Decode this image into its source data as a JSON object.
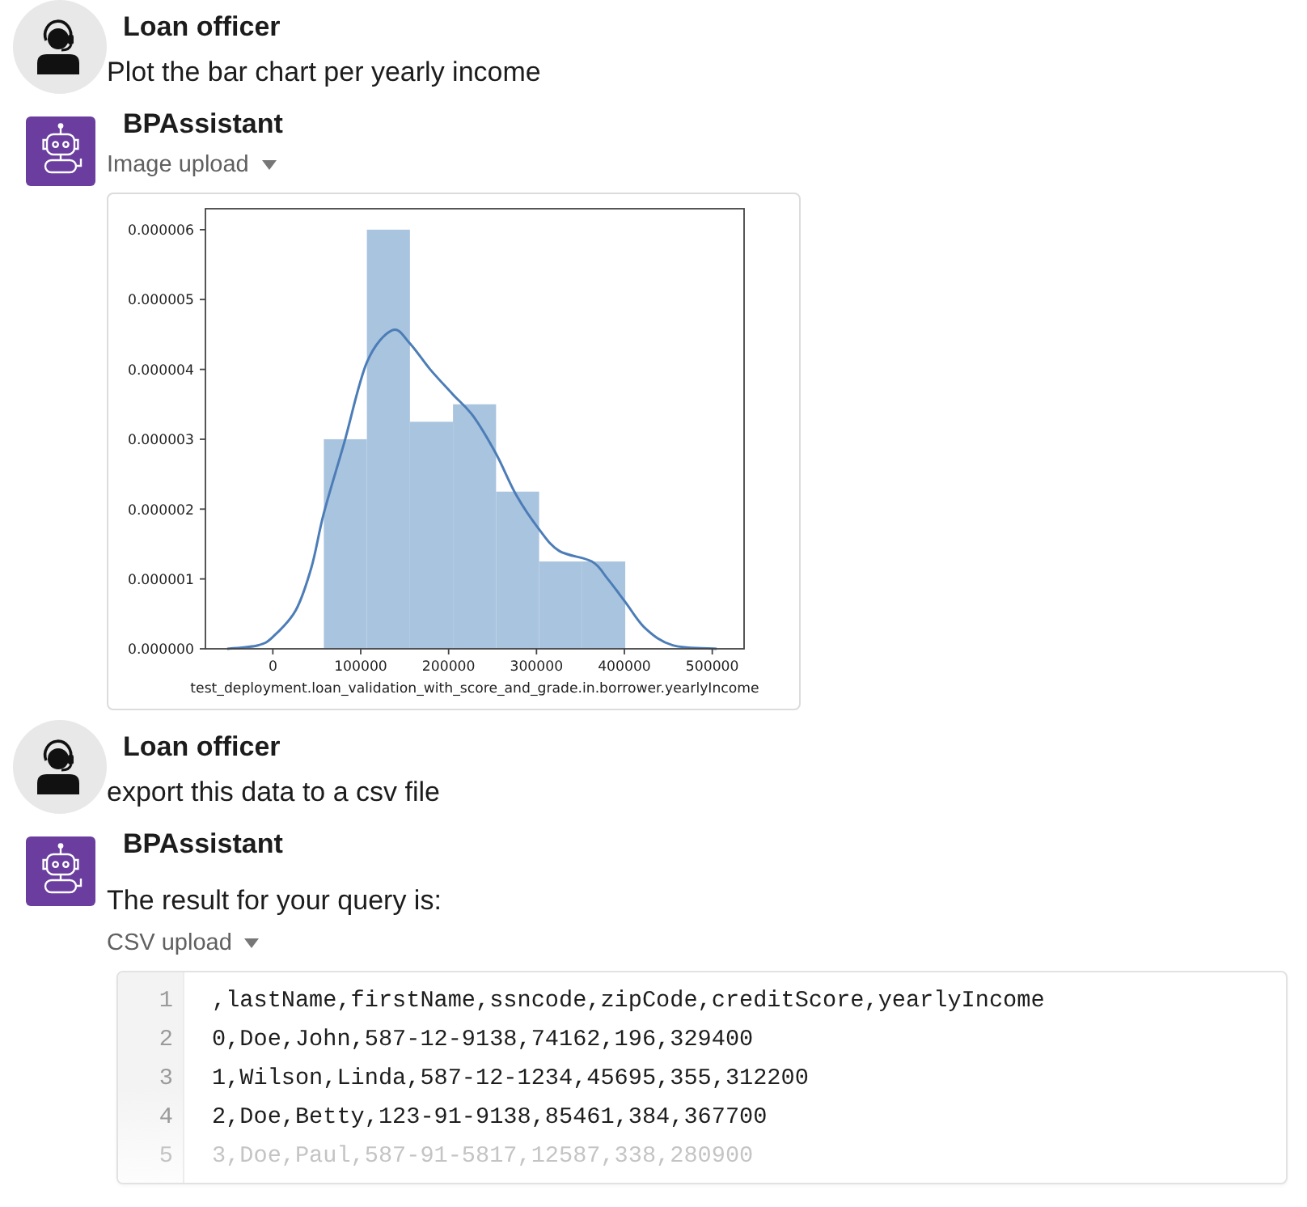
{
  "messages": [
    {
      "kind": "user",
      "author": "Loan officer",
      "text": "Plot the bar chart per yearly income"
    },
    {
      "kind": "bot",
      "author": "BPAssistant",
      "attachment": {
        "kind": "image",
        "label": "Image upload",
        "expanded": true,
        "chart_data": {
          "type": "bar",
          "xlabel": "test_deployment.loan_validation_with_score_and_grade.in.borrower.yearlyIncome",
          "x": [
            82500,
            131500,
            180500,
            229500,
            278500,
            327500,
            376500
          ],
          "series": [
            {
              "color": "#a9c4df",
              "values": [
                3e-06,
                6e-06,
                3.25e-06,
                3.5e-06,
                2.25e-06,
                1.25e-06,
                1.25e-06
              ]
            },
            {
              "type": "line",
              "color": "#4c7db7",
              "x": [
                -52000,
                -17000,
                0,
                26000,
                44000,
                58000,
                81000,
                107000,
                136000,
                156000,
                179000,
                205000,
                228000,
                254000,
                277000,
                303000,
                326000,
                363000,
                381000,
                401000,
                424000,
                455000,
                505000
              ],
              "values": [
                0,
                5e-08,
                1.7e-07,
                5.5e-07,
                1.17e-06,
                1.94e-06,
                2.94e-06,
                4.1e-06,
                4.56e-06,
                4.37e-06,
                4e-06,
                3.64e-06,
                3.33e-06,
                2.79e-06,
                2.2e-06,
                1.71e-06,
                1.4e-06,
                1.25e-06,
                1e-06,
                6.7e-07,
                2.9e-07,
                5e-08,
                0
              ]
            }
          ],
          "xlim": [
            -76700,
            536200
          ],
          "ylim": [
            0,
            6.3e-06
          ],
          "xticks": [
            0,
            100000,
            200000,
            300000,
            400000,
            500000
          ],
          "yticks": [
            {
              "value": 0,
              "label": "0.000000"
            },
            {
              "value": 1e-06,
              "label": "0.000001"
            },
            {
              "value": 2e-06,
              "label": "0.000002"
            },
            {
              "value": 3e-06,
              "label": "0.000003"
            },
            {
              "value": 4e-06,
              "label": "0.000004"
            },
            {
              "value": 5e-06,
              "label": "0.000005"
            },
            {
              "value": 6e-06,
              "label": "0.000006"
            }
          ]
        }
      }
    },
    {
      "kind": "user",
      "author": "Loan officer",
      "text": "export this data to a csv file"
    },
    {
      "kind": "bot",
      "author": "BPAssistant",
      "text": "The result for your query is:",
      "attachment": {
        "kind": "csv",
        "label": "CSV upload",
        "expanded": true,
        "lines": [
          {
            "number": "1",
            "text": ",lastName,firstName,ssncode,zipCode,creditScore,yearlyIncome",
            "faded": false
          },
          {
            "number": "2",
            "text": "0,Doe,John,587-12-9138,74162,196,329400",
            "faded": false
          },
          {
            "number": "3",
            "text": "1,Wilson,Linda,587-12-1234,45695,355,312200",
            "faded": false
          },
          {
            "number": "4",
            "text": "2,Doe,Betty,123-91-9138,85461,384,367700",
            "faded": false
          },
          {
            "number": "5",
            "text": "3,Doe,Paul,587-91-5817,12587,338,280900",
            "faded": true
          }
        ]
      }
    }
  ]
}
